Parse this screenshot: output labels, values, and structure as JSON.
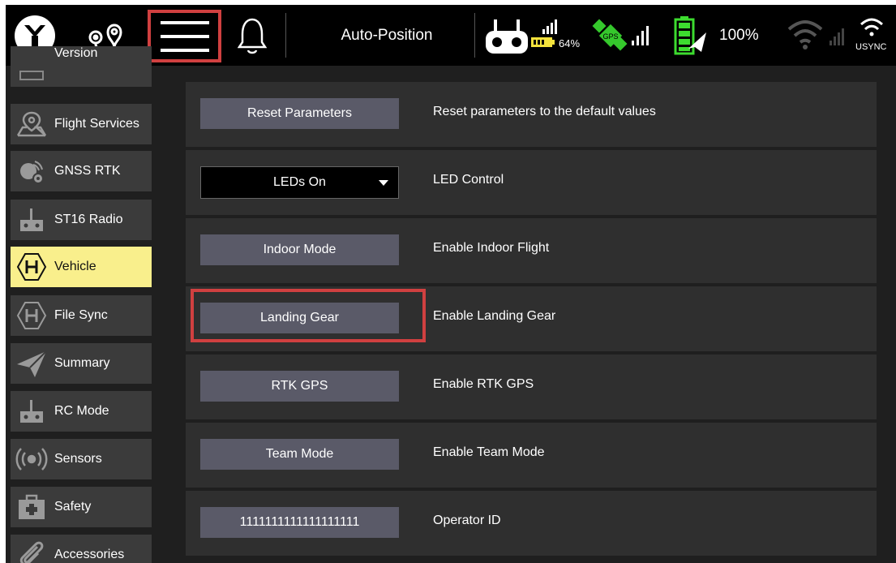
{
  "topbar": {
    "flight_mode": "Auto-Position",
    "rc_battery": "64%",
    "drone_battery": "100%",
    "wifi_label": "USYNC",
    "gps_label": "GPS"
  },
  "sidebar": {
    "items": [
      {
        "label": "Version",
        "icon": "version-icon"
      },
      {
        "label": "Flight Services",
        "icon": "map-pin-icon"
      },
      {
        "label": "GNSS RTK",
        "icon": "satellite-gear-icon"
      },
      {
        "label": "ST16 Radio",
        "icon": "remote-controller-icon"
      },
      {
        "label": "Vehicle",
        "icon": "hexagon-h-icon"
      },
      {
        "label": "File Sync",
        "icon": "hexagon-h-icon"
      },
      {
        "label": "Summary",
        "icon": "paper-plane-icon"
      },
      {
        "label": "RC Mode",
        "icon": "remote-controller-icon"
      },
      {
        "label": "Sensors",
        "icon": "broadcast-icon"
      },
      {
        "label": "Safety",
        "icon": "first-aid-kit-icon"
      },
      {
        "label": "Accessories",
        "icon": "paperclip-icon"
      }
    ],
    "active": "Vehicle"
  },
  "settings": {
    "rows": [
      {
        "control": "Reset Parameters",
        "description": "Reset parameters to the default values"
      },
      {
        "control": "LEDs On",
        "description": "LED Control"
      },
      {
        "control": "Indoor Mode",
        "description": "Enable Indoor Flight"
      },
      {
        "control": "Landing Gear",
        "description": "Enable Landing Gear"
      },
      {
        "control": "RTK GPS",
        "description": "Enable RTK GPS"
      },
      {
        "control": "Team Mode",
        "description": "Enable Team Mode"
      },
      {
        "control": "1111111111111111111",
        "description": "Operator ID"
      }
    ]
  },
  "colors": {
    "accent_active": "#f9ef8c",
    "highlight": "#d04040",
    "gps_green": "#35c82c",
    "battery_green": "#3ddc2f",
    "rc_battery_yellow": "#f4e23c"
  }
}
